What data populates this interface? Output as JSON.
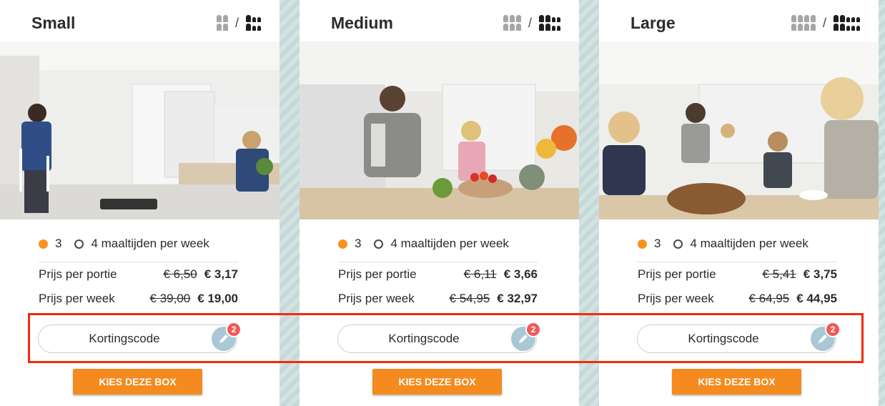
{
  "colors": {
    "accent": "#f58a1f",
    "highlight": "#f22a0c",
    "badge": "#ee5a5a",
    "pencil": "#a9c7d4"
  },
  "size_icons": {
    "separator": "/"
  },
  "cards": [
    {
      "title": "Small",
      "photo": "kitchen-photo-couple",
      "option_a": "3",
      "option_b": "4 maaltijden per week",
      "portion_label": "Prijs per portie",
      "portion_old": "€ 6,50",
      "portion_new": "€ 3,17",
      "week_label": "Prijs per week",
      "week_old": "€ 39,00",
      "week_new": "€ 19,00",
      "coupon_label": "Kortingscode",
      "badge": "2",
      "cta": "KIES DEZE BOX"
    },
    {
      "title": "Medium",
      "photo": "kitchen-photo-father-daughter",
      "option_a": "3",
      "option_b": "4 maaltijden per week",
      "portion_label": "Prijs per portie",
      "portion_old": "€ 6,11",
      "portion_new": "€ 3,66",
      "week_label": "Prijs per week",
      "week_old": "€ 54,95",
      "week_new": "€ 32,97",
      "coupon_label": "Kortingscode",
      "badge": "2",
      "cta": "KIES DEZE BOX"
    },
    {
      "title": "Large",
      "photo": "kitchen-photo-family",
      "option_a": "3",
      "option_b": "4 maaltijden per week",
      "portion_label": "Prijs per portie",
      "portion_old": "€ 5,41",
      "portion_new": "€ 3,75",
      "week_label": "Prijs per week",
      "week_old": "€ 64,95",
      "week_new": "€ 44,95",
      "coupon_label": "Kortingscode",
      "badge": "2",
      "cta": "KIES DEZE BOX"
    }
  ]
}
